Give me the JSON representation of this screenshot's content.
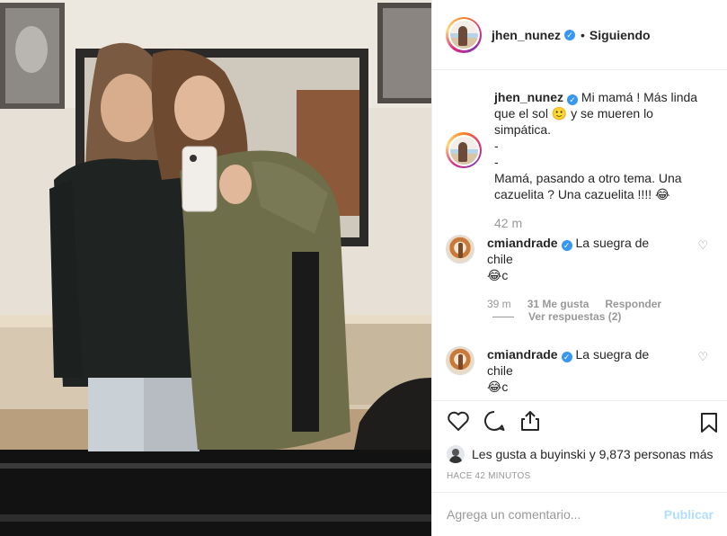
{
  "header": {
    "username": "jhen_nunez",
    "separator": "•",
    "follow_state": "Siguiendo"
  },
  "caption": {
    "username": "jhen_nunez",
    "lines": [
      "Mi mamá ! Más linda que el sol 🙂 y se mueren lo simpática.",
      "-",
      "-",
      "Mamá, pasando a otro tema. Una cazuelita ? Una cazuelita !!!! 😂"
    ],
    "time": "42 m"
  },
  "comments": [
    {
      "username": "cmiandrade",
      "text": "La suegra de chile",
      "text2": "😂c",
      "time": "39 m",
      "likes": "31 Me gusta",
      "reply": "Responder"
    },
    {
      "username": "cmiandrade",
      "text": "La suegra de chile",
      "text2": "😂c"
    }
  ],
  "view_replies": "Ver respuestas (2)",
  "likes_text": "Les gusta a buyinski y 9,873 personas más",
  "timestamp": "HACE 42 MINUTOS",
  "add_comment": {
    "placeholder": "Agrega un comentario...",
    "publish": "Publicar"
  },
  "icons": {
    "like": "heart-icon",
    "comment": "comment-icon",
    "share": "share-icon",
    "save": "bookmark-icon",
    "verified": "verified-badge-icon",
    "comment_like": "heart-outline-icon"
  },
  "colors": {
    "link_blue": "#3897f0",
    "publish_disabled": "#b2dffc",
    "muted": "#999999"
  }
}
